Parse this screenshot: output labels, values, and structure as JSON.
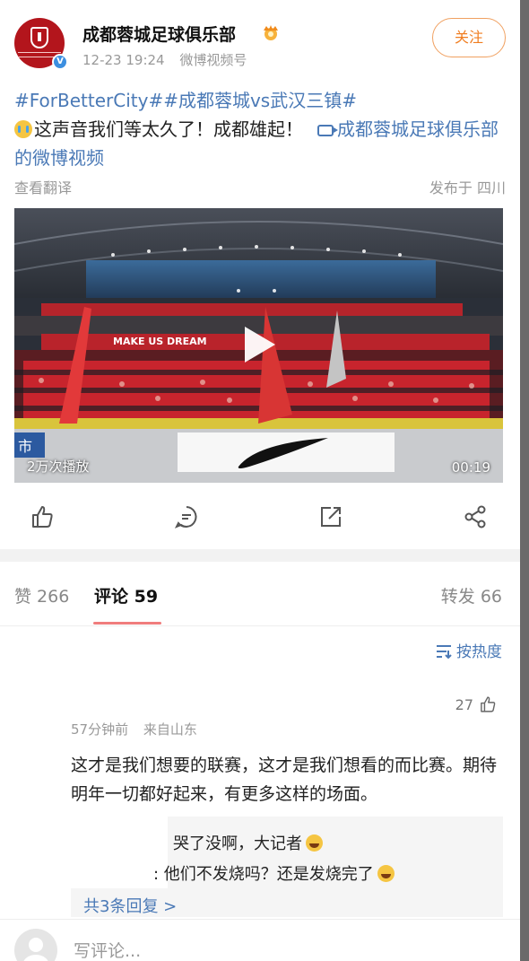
{
  "post": {
    "author": "成都蓉城足球俱乐部",
    "time": "12-23 19:24",
    "source": "微博视频号",
    "follow_label": "关注",
    "hashtags": "#ForBetterCity##成都蓉城vs武汉三镇#",
    "text": "这声音我们等太久了！成都雄起！",
    "video_link": "成都蓉城足球俱乐部的微博视频",
    "translate_label": "查看翻译",
    "location": "发布于 四川"
  },
  "video": {
    "banner_text": "MAKE US DREAM",
    "plays": "2万次播放",
    "duration": "00:19",
    "corner_text": "市"
  },
  "actions": [
    "like-icon",
    "comment-icon",
    "repost-icon",
    "share-icon"
  ],
  "tabs": {
    "likes": "赞 266",
    "comments": "评论 59",
    "reposts": "转发 66"
  },
  "sort_label": "按热度",
  "comment": {
    "likes": "27",
    "time": "57分钟前",
    "from": "来自山东",
    "text": "这才是我们想要的联赛，这才是我们想看的而比赛。期待明年一切都好起来，有更多这样的场面。",
    "reply1": "哭了没啊，大记者",
    "reply2": ": 他们不发烧吗？还是发烧完了",
    "more": "共3条回复 >"
  },
  "bottom": {
    "placeholder": "写评论..."
  },
  "colors": {
    "link": "#4a79b6",
    "follow": "#f07d20",
    "tab_underline": "#f07d7d"
  }
}
